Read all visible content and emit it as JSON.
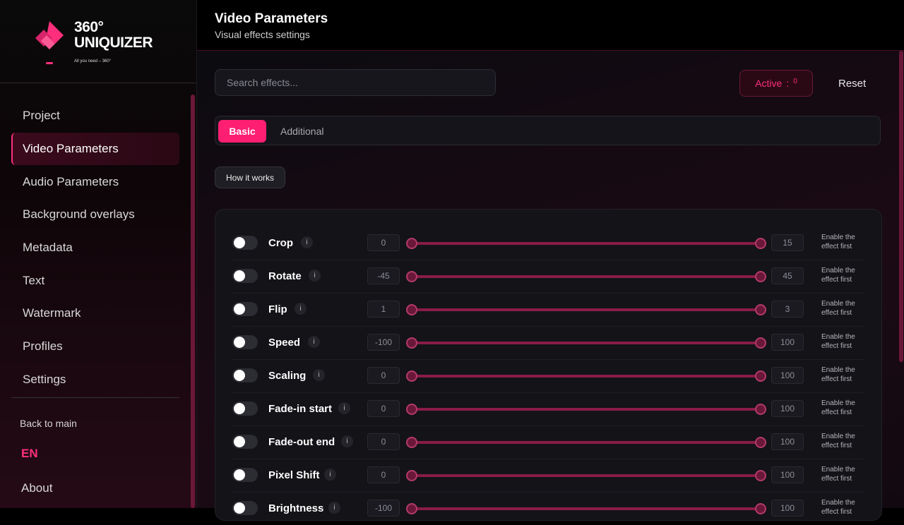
{
  "brand": {
    "title_line1": "360°",
    "title_line2": "UNIQUIZER",
    "tagline": "All you need – 360°",
    "accent": "#ff2f7d"
  },
  "sidebar": {
    "items": [
      {
        "label": "Project"
      },
      {
        "label": "Video Parameters",
        "active": true
      },
      {
        "label": "Audio Parameters"
      },
      {
        "label": "Background overlays"
      },
      {
        "label": "Metadata"
      },
      {
        "label": "Text"
      },
      {
        "label": "Watermark"
      },
      {
        "label": "Profiles"
      },
      {
        "label": "Settings"
      }
    ],
    "back_label": "Back to main",
    "language": "EN",
    "about_label": "About"
  },
  "header": {
    "title": "Video Parameters",
    "subtitle": "Visual effects settings"
  },
  "toolbar": {
    "search_placeholder": "Search effects...",
    "active_label": "Active",
    "active_separator": ":",
    "active_count": "0",
    "reset_label": "Reset"
  },
  "tabs": [
    {
      "label": "Basic",
      "active": true
    },
    {
      "label": "Additional",
      "active": false
    }
  ],
  "how_label": "How it works",
  "effects": [
    {
      "label": "Crop",
      "min": "0",
      "max": "15",
      "enabled": false,
      "hint": "Enable the effect first"
    },
    {
      "label": "Rotate",
      "min": "-45",
      "max": "45",
      "enabled": false,
      "hint": "Enable the effect first"
    },
    {
      "label": "Flip",
      "min": "1",
      "max": "3",
      "enabled": false,
      "hint": "Enable the effect first"
    },
    {
      "label": "Speed",
      "min": "-100",
      "max": "100",
      "enabled": false,
      "hint": "Enable the effect first"
    },
    {
      "label": "Scaling",
      "min": "0",
      "max": "100",
      "enabled": false,
      "hint": "Enable the effect first"
    },
    {
      "label": "Fade-in start",
      "min": "0",
      "max": "100",
      "enabled": false,
      "hint": "Enable the effect first"
    },
    {
      "label": "Fade-out end",
      "min": "0",
      "max": "100",
      "enabled": false,
      "hint": "Enable the effect first"
    },
    {
      "label": "Pixel Shift",
      "min": "0",
      "max": "100",
      "enabled": false,
      "hint": "Enable the effect first"
    },
    {
      "label": "Brightness",
      "min": "-100",
      "max": "100",
      "enabled": false,
      "hint": "Enable the effect first"
    }
  ],
  "info_glyph": "i"
}
